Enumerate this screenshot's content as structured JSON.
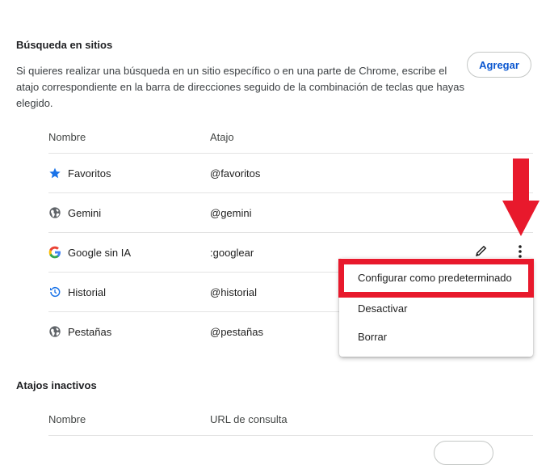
{
  "site_search": {
    "title": "Búsqueda en sitios",
    "description": "Si quieres realizar una búsqueda en un sitio específico o en una parte de Chrome, escribe el atajo correspondiente en la barra de direcciones seguido de la combinación de teclas que hayas elegido.",
    "add_button": "Agregar",
    "columns": {
      "name": "Nombre",
      "shortcut": "Atajo"
    },
    "rows": [
      {
        "name": "Favoritos",
        "shortcut": "@favoritos",
        "icon": "star-icon"
      },
      {
        "name": "Gemini",
        "shortcut": "@gemini",
        "icon": "globe-icon"
      },
      {
        "name": "Google sin IA",
        "shortcut": ":googlear",
        "icon": "google-g-icon"
      },
      {
        "name": "Historial",
        "shortcut": "@historial",
        "icon": "history-icon"
      },
      {
        "name": "Pestañas",
        "shortcut": "@pestañas",
        "icon": "globe-icon"
      }
    ]
  },
  "context_menu": {
    "items": [
      "Configurar como predeterminado",
      "Desactivar",
      "Borrar"
    ]
  },
  "inactive": {
    "title": "Atajos inactivos",
    "columns": {
      "name": "Nombre",
      "url": "URL de consulta"
    }
  },
  "colors": {
    "accent": "#0b57d0",
    "annotation_red": "#e8192c"
  }
}
